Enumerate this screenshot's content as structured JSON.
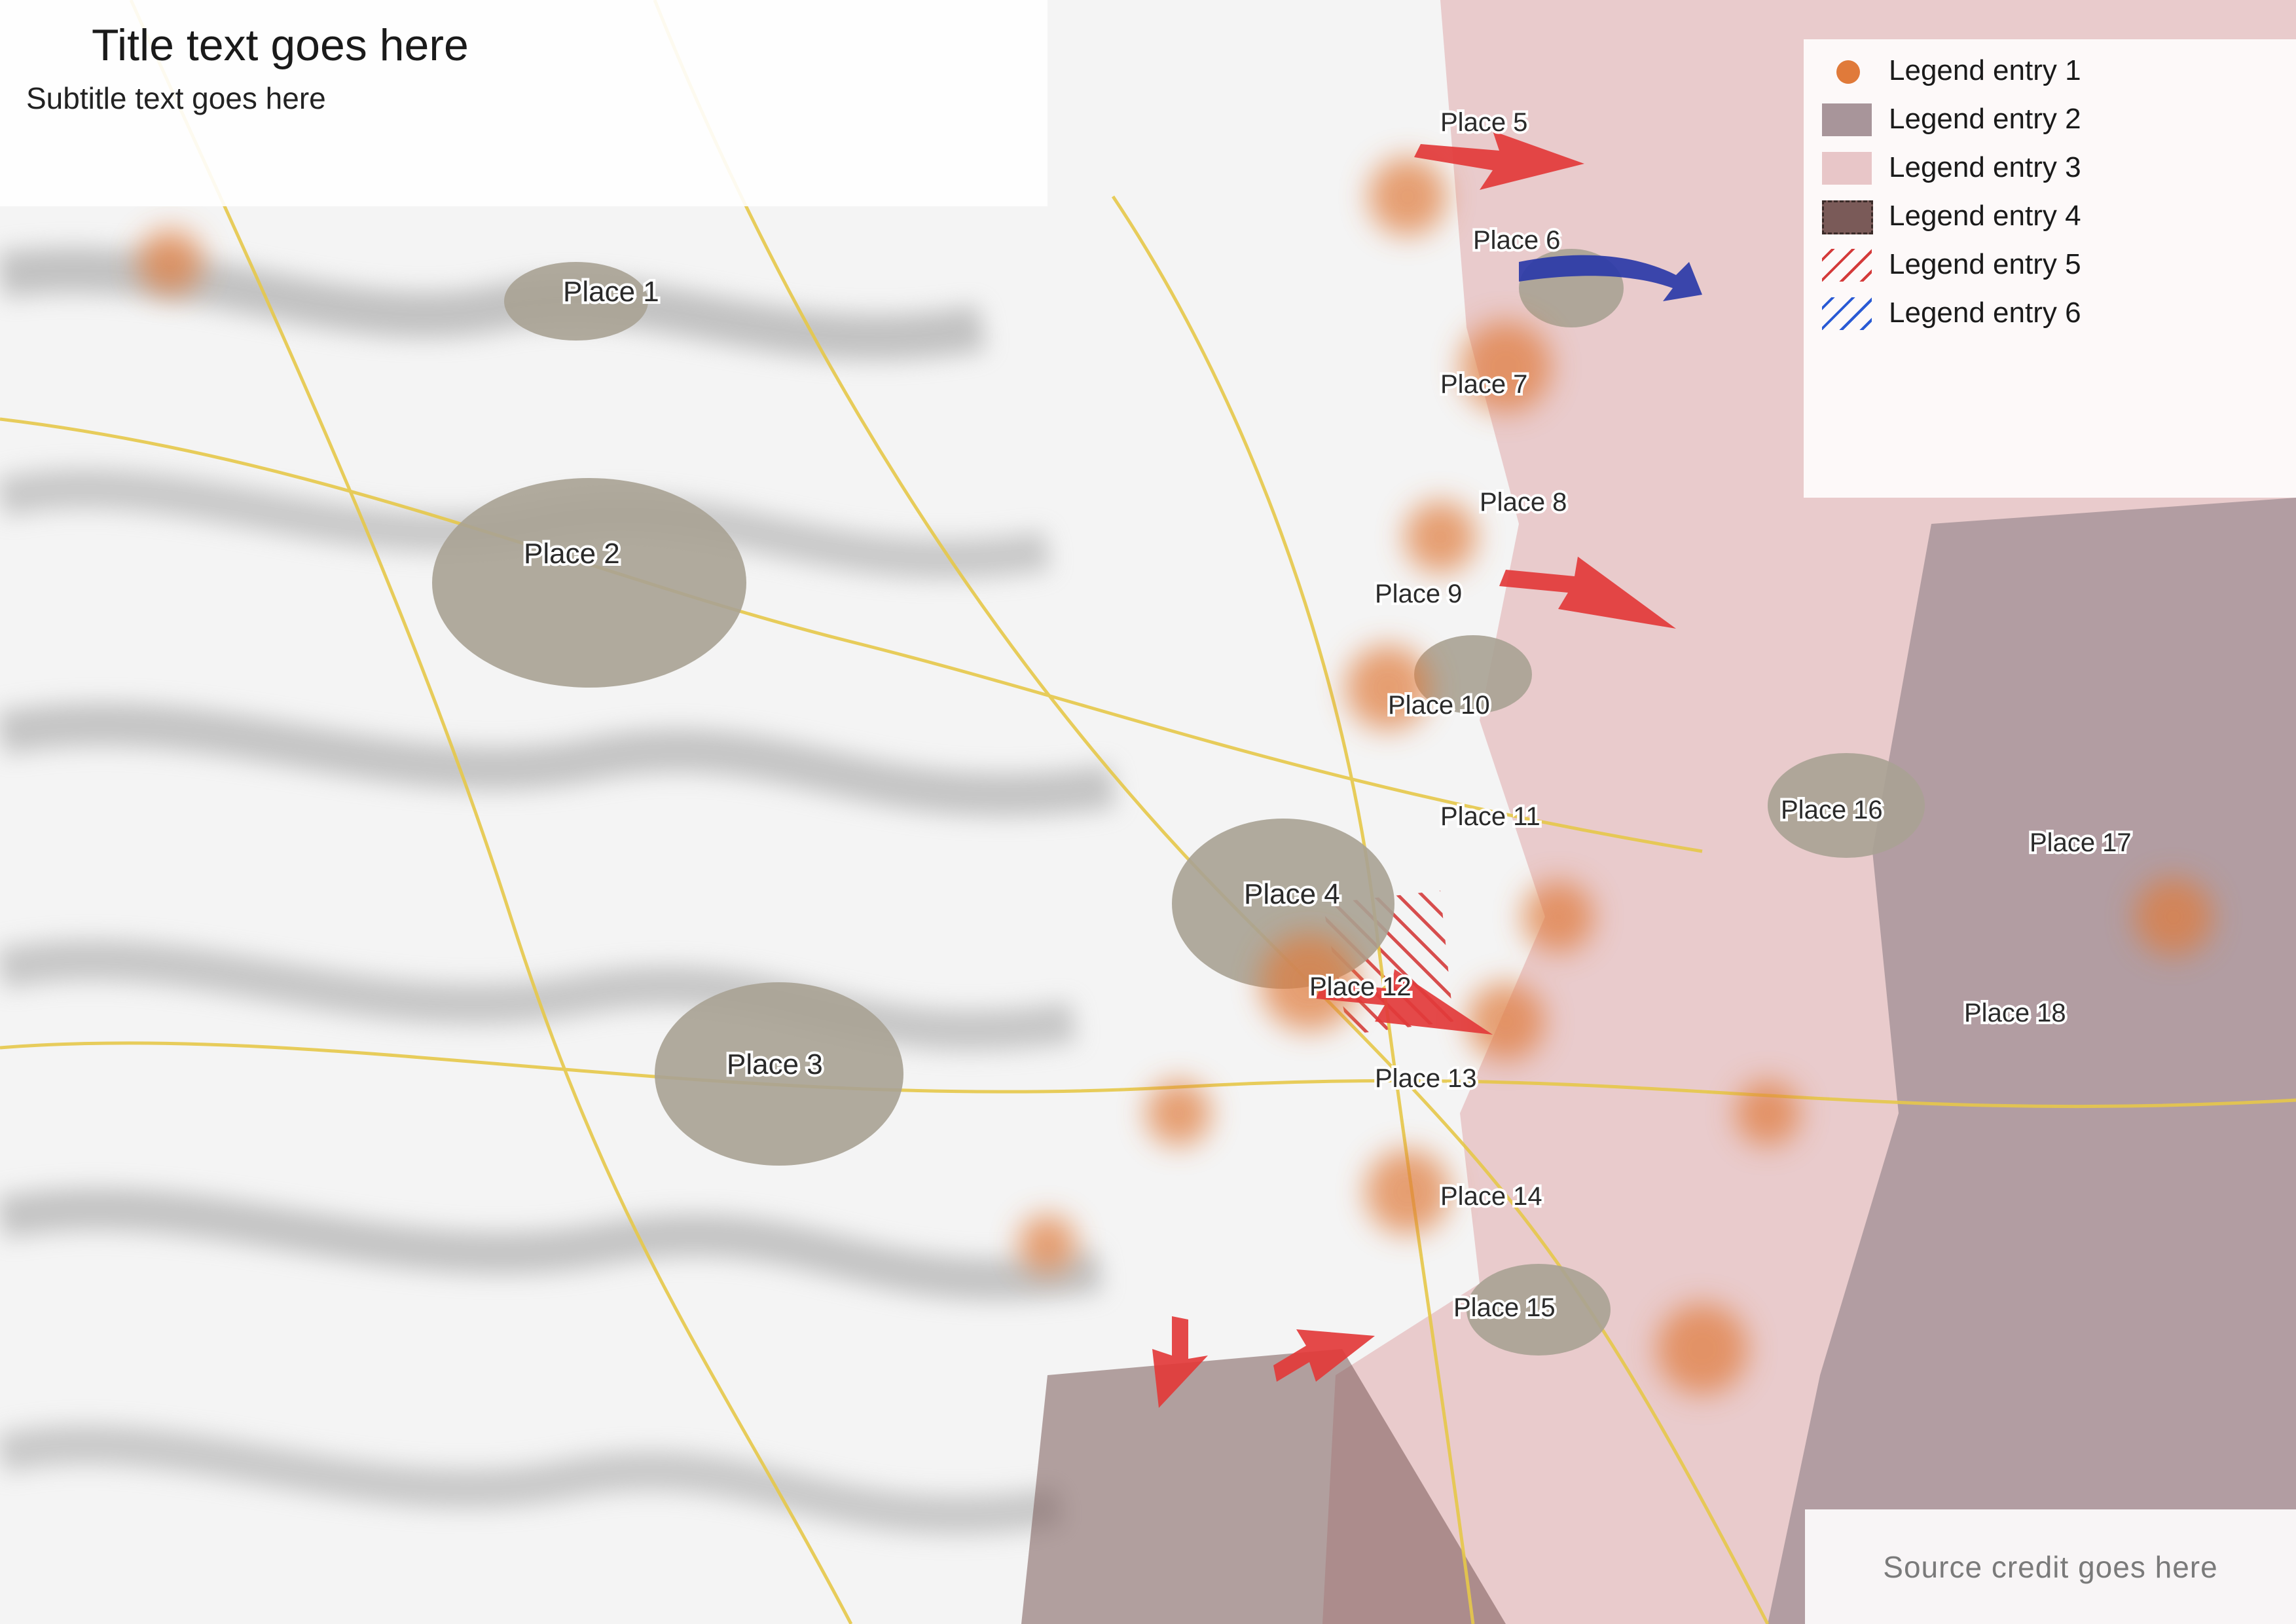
{
  "title": "Title text goes here",
  "subtitle": "Subtitle text goes here",
  "legend": [
    {
      "key": "fires",
      "label": "Legend entry 1"
    },
    {
      "key": "occupied_before",
      "label": "Legend entry 2"
    },
    {
      "key": "occupied_after",
      "label": "Legend entry 3"
    },
    {
      "key": "russia",
      "label": "Legend entry 4"
    },
    {
      "key": "newly_occupied",
      "label": "Legend entry 5"
    },
    {
      "key": "liberated",
      "label": "Legend entry 6"
    }
  ],
  "source": "Source credit goes here",
  "colors": {
    "fire": "#e07a3a",
    "occupied_before": "#a8959a",
    "occupied_after": "#e8c6c8",
    "russia": "#7a5a58",
    "attack_arrow": "#e23a3a",
    "counter_arrow": "#2a3aa8",
    "road": "#e6c84a",
    "settlement": "#a8a294"
  },
  "places": [
    {
      "id": "p01",
      "name": "Place 1"
    },
    {
      "id": "p02",
      "name": "Place 2"
    },
    {
      "id": "p03",
      "name": "Place 3"
    },
    {
      "id": "p04",
      "name": "Place 4"
    },
    {
      "id": "p05",
      "name": "Place 5"
    },
    {
      "id": "p06",
      "name": "Place 6"
    },
    {
      "id": "p07",
      "name": "Place 7"
    },
    {
      "id": "p08",
      "name": "Place 8"
    },
    {
      "id": "p09",
      "name": "Place 9"
    },
    {
      "id": "p10",
      "name": "Place 10"
    },
    {
      "id": "p11",
      "name": "Place 11"
    },
    {
      "id": "p12",
      "name": "Place 12"
    },
    {
      "id": "p13",
      "name": "Place 13"
    },
    {
      "id": "p14",
      "name": "Place 14"
    },
    {
      "id": "p15",
      "name": "Place 15"
    },
    {
      "id": "p16",
      "name": "Place 16"
    },
    {
      "id": "p17",
      "name": "Place 17"
    },
    {
      "id": "p18",
      "name": "Place 18"
    }
  ]
}
